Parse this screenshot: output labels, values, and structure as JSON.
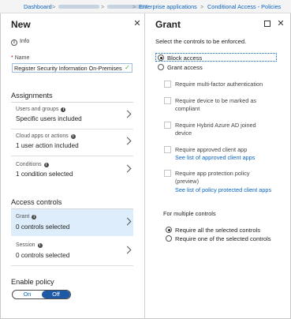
{
  "breadcrumb": {
    "items": [
      "Dashboard",
      "Enterprise applications",
      "Conditional Access - Policies"
    ],
    "separator": ">"
  },
  "new_blade": {
    "title": "New",
    "info_label": "Info",
    "name_label": "Name",
    "name_value": "Register Security Information On-Premises",
    "assignments_title": "Assignments",
    "assignments": [
      {
        "label": "Users and groups",
        "value": "Specific users included"
      },
      {
        "label": "Cloud apps or actions",
        "value": "1 user action included"
      },
      {
        "label": "Conditions",
        "value": "1 condition selected"
      }
    ],
    "access_controls_title": "Access controls",
    "access_controls": [
      {
        "label": "Grant",
        "value": "0 controls selected"
      },
      {
        "label": "Session",
        "value": "0 controls selected"
      }
    ],
    "enable_policy_title": "Enable policy",
    "toggle": {
      "on": "On",
      "off": "Off",
      "selected": "Off"
    }
  },
  "grant_blade": {
    "title": "Grant",
    "description": "Select the controls to be enforced.",
    "radios": [
      {
        "label": "Block access",
        "checked": true
      },
      {
        "label": "Grant access",
        "checked": false
      }
    ],
    "controls": [
      {
        "label": "Require multi-factor authentication",
        "link": ""
      },
      {
        "label": "Require device to be marked as compliant",
        "link": ""
      },
      {
        "label": "Require Hybrid Azure AD joined device",
        "link": ""
      },
      {
        "label": "Require approved client app",
        "link": "See list of approved client apps"
      },
      {
        "label": "Require app protection policy (preview)",
        "link": "See list of policy protected client apps"
      }
    ],
    "multiple_title": "For multiple controls",
    "multiple_radios": [
      {
        "label": "Require all the selected controls",
        "checked": true
      },
      {
        "label": "Require one of the selected controls",
        "checked": false
      }
    ]
  },
  "colors": {
    "accent": "#0a64c2",
    "selected_row": "#ddedfb",
    "toggle_on": "#1d5aa5"
  }
}
